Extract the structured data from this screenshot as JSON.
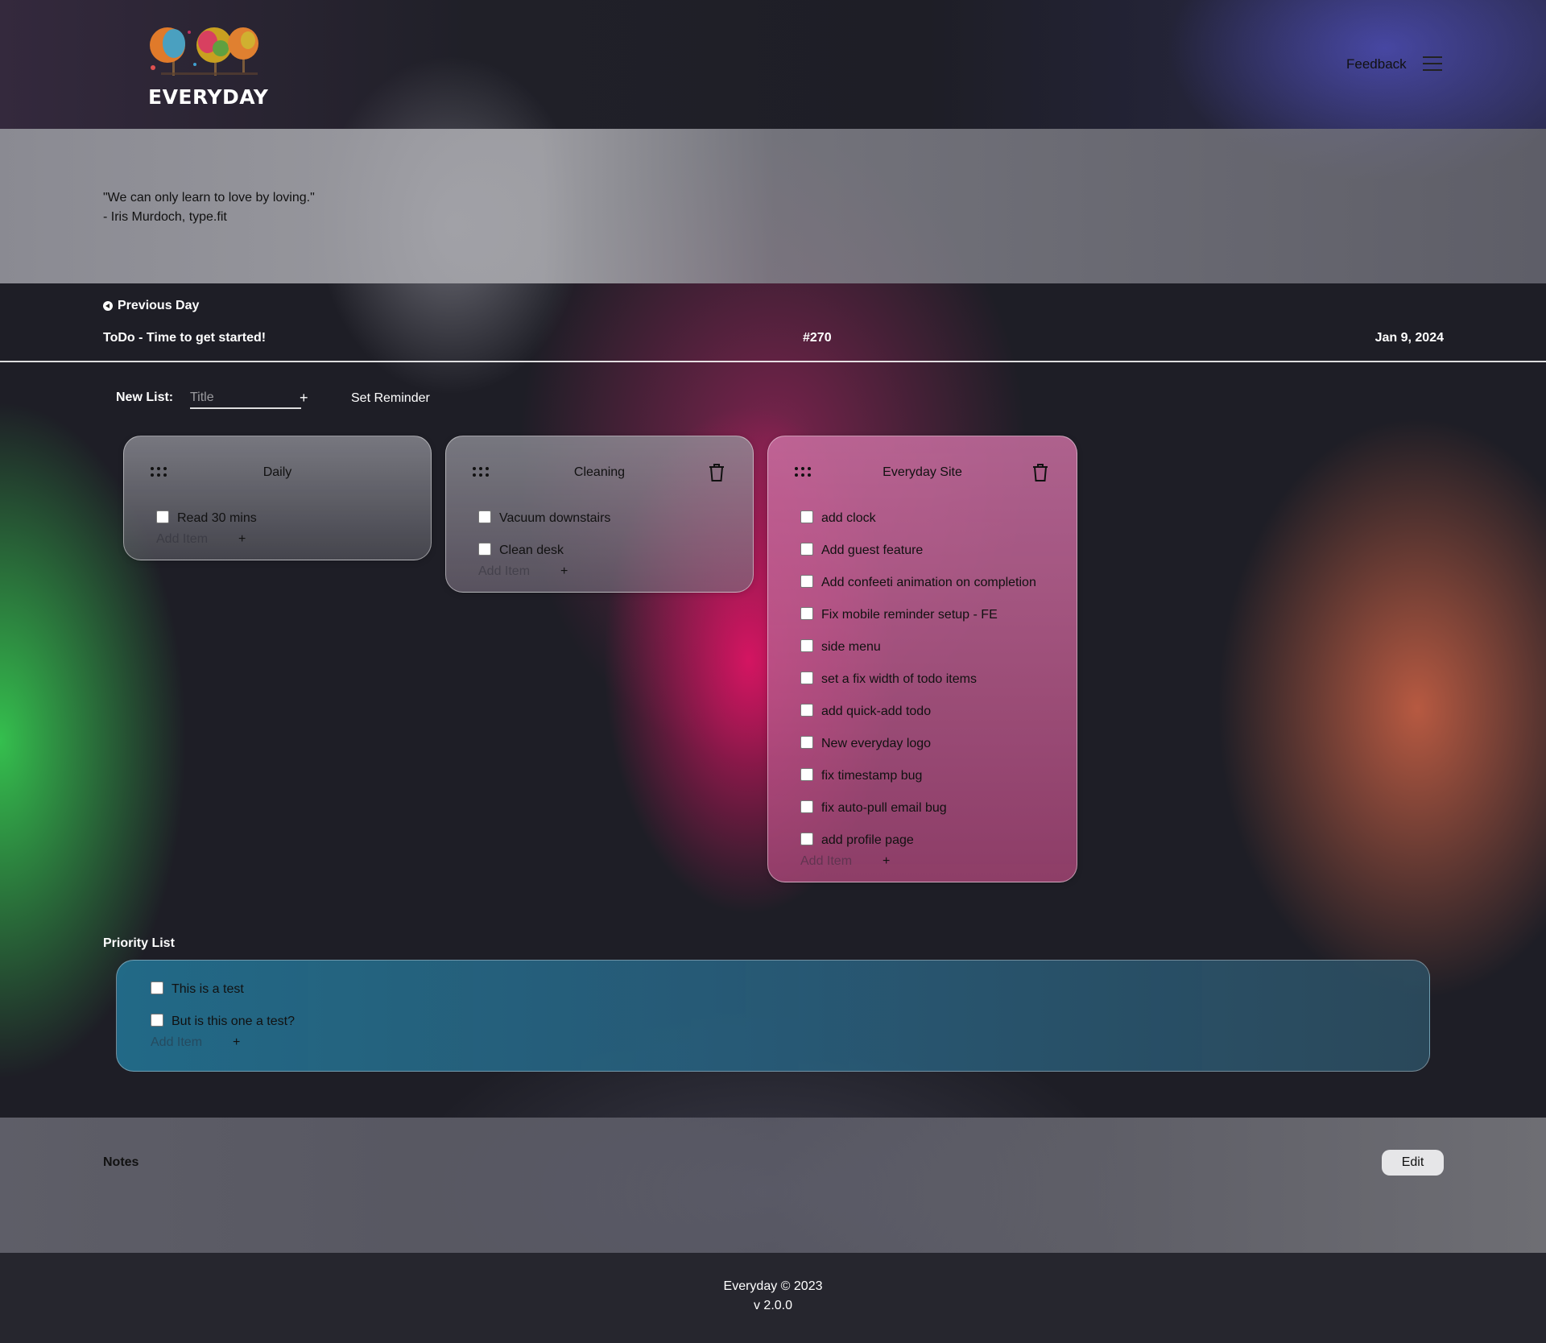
{
  "app": {
    "logo_text": "EVERYDAY",
    "feedback_label": "Feedback",
    "menu_icon": "hamburger-menu-icon"
  },
  "quote": {
    "text": "\"We can only learn to love by loving.\"",
    "author": "- Iris Murdoch, type.fit"
  },
  "day": {
    "previous_label": "Previous Day",
    "heading": "ToDo - Time to get started!",
    "number": "#270",
    "date": "Jan 9, 2024"
  },
  "new_list": {
    "label": "New List:",
    "placeholder": "Title",
    "add_label": "+",
    "reminder_label": "Set Reminder"
  },
  "lists": [
    {
      "title": "Daily",
      "items": [
        "Read 30 mins"
      ],
      "add_placeholder": "Add Item",
      "add_label": "+"
    },
    {
      "title": "Cleaning",
      "items": [
        "Vacuum downstairs",
        "Clean desk"
      ],
      "add_placeholder": "Add Item",
      "add_label": "+"
    },
    {
      "title": "Everyday Site",
      "items": [
        "add clock",
        "Add guest feature",
        "Add confeeti animation on completion",
        "Fix mobile reminder setup - FE",
        "side menu",
        "set a fix width of todo items",
        "add quick-add todo",
        "New everyday logo",
        "fix timestamp bug",
        "fix auto-pull email bug",
        "add profile page"
      ],
      "add_placeholder": "Add Item",
      "add_label": "+"
    }
  ],
  "priority": {
    "label": "Priority List",
    "items": [
      "This is a test",
      "But is this one a test?"
    ],
    "add_placeholder": "Add Item",
    "add_label": "+"
  },
  "notes": {
    "label": "Notes",
    "edit_label": "Edit"
  },
  "footer": {
    "copyright": "Everyday © 2023",
    "version": "v 2.0.0"
  },
  "colors": {
    "priority_bg": "#236e8c",
    "site_card_bg": "#c86ea0",
    "footer_bg": "#26262e"
  }
}
